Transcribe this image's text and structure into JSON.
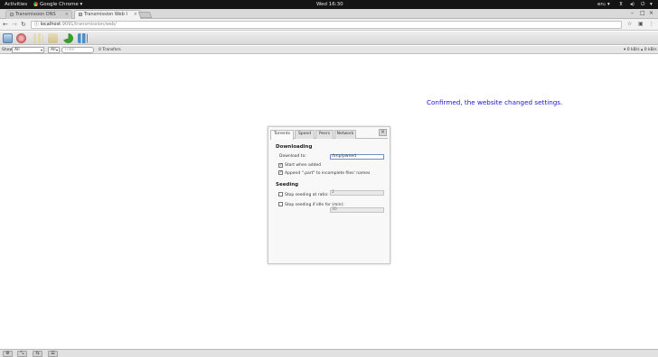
{
  "gnome": {
    "activities": "Activities",
    "app_name": "Google Chrome",
    "clock": "Wed 16:30",
    "locale": "en₁"
  },
  "chrome": {
    "tabs": [
      {
        "label": "Transmission DNS",
        "active": false
      },
      {
        "label": "Transmission Web I",
        "active": true
      }
    ],
    "address_host": "localhost",
    "address_rest": ":9091/transmission/web/"
  },
  "filterbar": {
    "show_label": "Show",
    "state_filter": "All",
    "tracker_filter": "All",
    "search_placeholder": "Filter",
    "transfers": "0 Transfers",
    "down_speed": "▾ 0 kB/s",
    "up_speed": "▴ 0 kB/s"
  },
  "overlay": {
    "message": "Confirmed, the website changed settings."
  },
  "preferences": {
    "tabs": [
      "Torrents",
      "Speed",
      "Peers",
      "Network"
    ],
    "active_tab": "Torrents",
    "close": "×",
    "downloading": {
      "heading": "Downloading",
      "download_to_label": "Download to:",
      "download_to_value": "/tmp/pwned",
      "start_when_added_label": "Start when added",
      "start_when_added_checked": true,
      "append_part_label": "Append \".part\" to incomplete files' names",
      "append_part_checked": true
    },
    "seeding": {
      "heading": "Seeding",
      "stop_ratio_label": "Stop seeding at ratio:",
      "stop_ratio_checked": false,
      "stop_ratio_value": "2",
      "stop_idle_label": "Stop seeding if idle for (min):",
      "stop_idle_checked": false,
      "stop_idle_value": "30"
    }
  },
  "bottombar": {
    "buttons": [
      "⚙",
      "⤡",
      "⇆",
      "☰"
    ]
  }
}
